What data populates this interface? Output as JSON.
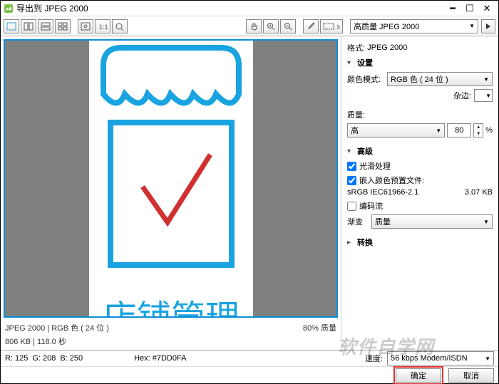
{
  "window": {
    "title": "导出到 JPEG 2000"
  },
  "toolbar": {
    "preset": "高质量 JPEG 2000"
  },
  "preview": {
    "art_text": "店铺管理",
    "info_left": "JPEG 2000  |  RGB 色 ( 24 位 )",
    "info_right": "80% 质量",
    "size_time": "806 KB  |  118.0 秒"
  },
  "props": {
    "format_label": "格式:",
    "format_value": "JPEG 2000",
    "settings_header": "设置",
    "color_mode_label": "颜色模式:",
    "color_mode_value": "RGB 色 ( 24 位 )",
    "matte_label": "杂边:",
    "quality_label": "质量:",
    "quality_level": "高",
    "quality_value": "80",
    "quality_suffix": "%",
    "advanced_header": "高级",
    "smooth_label": "光滑处理",
    "embed_profile_label": "嵌入颜色预置文件:",
    "profile_name": "sRGB IEC61966-2.1",
    "profile_size": "3.07 KB",
    "codestream_label": "编码流",
    "progressive_label": "渐变",
    "progressive_value": "质量",
    "transform_header": "转换"
  },
  "footer": {
    "r_label": "R:",
    "r": "125",
    "g_label": "G:",
    "g": "208",
    "b_label": "B:",
    "b": "250",
    "hex_label": "Hex:",
    "hex": "#7DD0FA",
    "speed_label": "速度:",
    "speed_value": "56 kbps Modem/ISDN",
    "ok": "确定",
    "cancel": "取消"
  },
  "watermark": "软件自学网"
}
